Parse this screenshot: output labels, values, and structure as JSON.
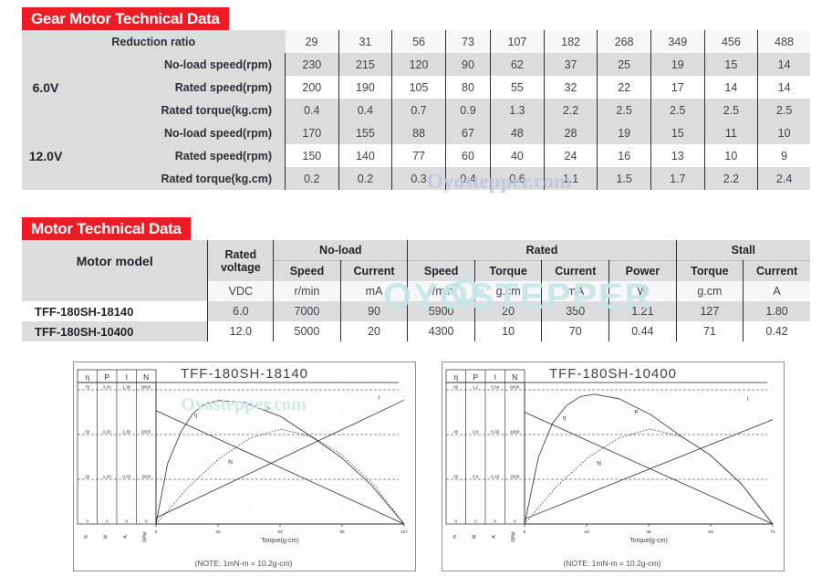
{
  "gear_section": {
    "title": "Gear Motor Technical Data",
    "row_label_reduction": "Reduction ratio",
    "voltage_groups": [
      {
        "voltage": "6.0V",
        "rows": [
          {
            "label": "No-load speed(rpm)",
            "values": [
              "230",
              "215",
              "120",
              "90",
              "62",
              "37",
              "25",
              "19",
              "15",
              "14"
            ]
          },
          {
            "label": "Rated speed(rpm)",
            "values": [
              "200",
              "190",
              "105",
              "80",
              "55",
              "32",
              "22",
              "17",
              "14",
              "14"
            ]
          },
          {
            "label": "Rated torque(kg.cm)",
            "values": [
              "0.4",
              "0.4",
              "0.7",
              "0.9",
              "1.3",
              "2.2",
              "2.5",
              "2.5",
              "2.5",
              "2.5"
            ]
          }
        ]
      },
      {
        "voltage": "12.0V",
        "rows": [
          {
            "label": "No-load speed(rpm)",
            "values": [
              "170",
              "155",
              "88",
              "67",
              "48",
              "28",
              "19",
              "15",
              "11",
              "10"
            ]
          },
          {
            "label": "Rated speed(rpm)",
            "values": [
              "150",
              "140",
              "77",
              "60",
              "40",
              "24",
              "16",
              "13",
              "10",
              "9"
            ]
          },
          {
            "label": "Rated torque(kg.cm)",
            "values": [
              "0.2",
              "0.2",
              "0.3",
              "0.4",
              "0.6",
              "1.1",
              "1.5",
              "1.7",
              "2.2",
              "2.4"
            ]
          }
        ]
      }
    ],
    "reduction_ratios": [
      "29",
      "31",
      "56",
      "73",
      "107",
      "182",
      "268",
      "349",
      "456",
      "488"
    ]
  },
  "motor_section": {
    "title": "Motor Technical Data",
    "header": {
      "model": "Motor model",
      "rated_voltage": "Rated\nvoltage",
      "rated_voltage_line1": "Rated",
      "rated_voltage_line2": "voltage",
      "group_noload": "No-load",
      "group_rated": "Rated",
      "group_stall": "Stall",
      "speed": "Speed",
      "current": "Current",
      "torque": "Torque",
      "power": "Power"
    },
    "units": [
      "VDC",
      "r/min",
      "mA",
      "r/min",
      "g.cm",
      "mA",
      "W",
      "g.cm",
      "A"
    ],
    "rows": [
      {
        "model": "TFF-180SH-18140",
        "values": [
          "6.0",
          "7000",
          "90",
          "5900",
          "20",
          "350",
          "1.21",
          "127",
          "1.80"
        ]
      },
      {
        "model": "TFF-180SH-10400",
        "values": [
          "12.0",
          "5000",
          "20",
          "4300",
          "10",
          "70",
          "0.44",
          "71",
          "0.42"
        ]
      }
    ]
  },
  "watermarks": {
    "gear_table": "Oyostepper.com",
    "motor_table": "OYOSTEPPER",
    "chart": "Oyostepper.com"
  },
  "chart_data": [
    {
      "type": "line",
      "title": "TFF-180SH-18140",
      "xlabel": "Torque(g-cm)",
      "note": "(NOTE: 1mN-m = 10.2g-cm)",
      "xticks": [
        "0",
        "32",
        "64",
        "95",
        "127"
      ],
      "xlim": [
        0,
        127
      ],
      "grid": true,
      "legend_position": "inline-labels",
      "scale_columns": [
        {
          "symbol": "η",
          "unit": "%",
          "ticks": [
            "0",
            "25",
            "50",
            "75"
          ]
        },
        {
          "symbol": "P",
          "unit": "W",
          "ticks": [
            "0",
            "1.00",
            "2.00",
            "3.00"
          ]
        },
        {
          "symbol": "I",
          "unit": "A",
          "ticks": [
            "0",
            "0.65",
            "1.30",
            "1.95"
          ]
        },
        {
          "symbol": "N",
          "unit": "RPM",
          "ticks": [
            "0",
            "3000",
            "6000",
            "9000"
          ]
        }
      ],
      "series": [
        {
          "name": "η",
          "label": "η",
          "style": "solid",
          "x": [
            0,
            6,
            13,
            19,
            25,
            32,
            45,
            64,
            82,
            95,
            110,
            127
          ],
          "y": [
            0,
            34,
            52,
            62,
            67,
            69,
            68,
            60,
            47,
            37,
            22,
            0
          ]
        },
        {
          "name": "P",
          "label": "P",
          "style": "dotted",
          "x": [
            0,
            16,
            32,
            48,
            64,
            80,
            95,
            111,
            127
          ],
          "y": [
            0,
            0.8,
            1.45,
            1.92,
            2.12,
            1.95,
            1.55,
            0.9,
            0
          ]
        },
        {
          "name": "N",
          "label": "N",
          "style": "solid",
          "x": [
            0,
            127
          ],
          "y": [
            7600,
            0
          ]
        },
        {
          "name": "I",
          "label": "I",
          "style": "solid",
          "x": [
            0,
            127
          ],
          "y": [
            0.09,
            1.8
          ]
        }
      ]
    },
    {
      "type": "line",
      "title": "TFF-180SH-10400",
      "xlabel": "Torque(g-cm)",
      "note": "(NOTE: 1mN-m = 10.2g-cm)",
      "xticks": [
        "0",
        "18",
        "36",
        "53",
        "71"
      ],
      "xlim": [
        0,
        71
      ],
      "grid": true,
      "legend_position": "inline-labels",
      "scale_columns": [
        {
          "symbol": "η",
          "unit": "%",
          "ticks": [
            "0",
            "20",
            "40",
            "60"
          ]
        },
        {
          "symbol": "P",
          "unit": "W",
          "ticks": [
            "0",
            "0.4",
            "0.8",
            "1.2"
          ]
        },
        {
          "symbol": "I",
          "unit": "A",
          "ticks": [
            "0",
            "0.18",
            "0.36",
            "0.54"
          ]
        },
        {
          "symbol": "N",
          "unit": "RPM",
          "ticks": [
            "0",
            "2000",
            "4000",
            "6000"
          ]
        }
      ],
      "series": [
        {
          "name": "η",
          "label": "η",
          "style": "solid",
          "x": [
            0,
            4,
            8,
            12,
            16,
            20,
            27,
            36,
            45,
            53,
            62,
            71
          ],
          "y": [
            0,
            30,
            45,
            53,
            57,
            58,
            56,
            49,
            39,
            31,
            18,
            0
          ]
        },
        {
          "name": "P",
          "label": "P",
          "style": "dotted",
          "x": [
            0,
            9,
            18,
            27,
            36,
            45,
            53,
            62,
            71
          ],
          "y": [
            0,
            0.33,
            0.59,
            0.77,
            0.85,
            0.78,
            0.62,
            0.36,
            0
          ]
        },
        {
          "name": "N",
          "label": "N",
          "style": "solid",
          "x": [
            0,
            71
          ],
          "y": [
            5000,
            0
          ]
        },
        {
          "name": "I",
          "label": "I",
          "style": "solid",
          "x": [
            0,
            71
          ],
          "y": [
            0.02,
            0.42
          ]
        }
      ]
    }
  ]
}
